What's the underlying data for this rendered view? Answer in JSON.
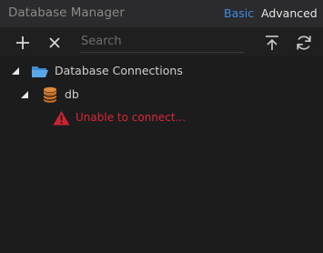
{
  "header": {
    "title": "Database Manager",
    "mode_basic": "Basic",
    "mode_advanced": "Advanced",
    "accent_color": "#3f8be0"
  },
  "toolbar": {
    "add_icon": "plus-icon",
    "remove_icon": "close-icon",
    "search_placeholder": "Search",
    "search_value": "",
    "upload_icon": "upload-icon",
    "refresh_icon": "refresh-icon"
  },
  "tree": {
    "root": {
      "label": "Database Connections",
      "icon": "folder-icon",
      "expanded": true
    },
    "connection": {
      "label": "db",
      "icon": "database-icon",
      "expanded": true
    },
    "error": {
      "label": "Unable to connect...",
      "icon": "warning-icon",
      "color": "#d7263a"
    }
  }
}
